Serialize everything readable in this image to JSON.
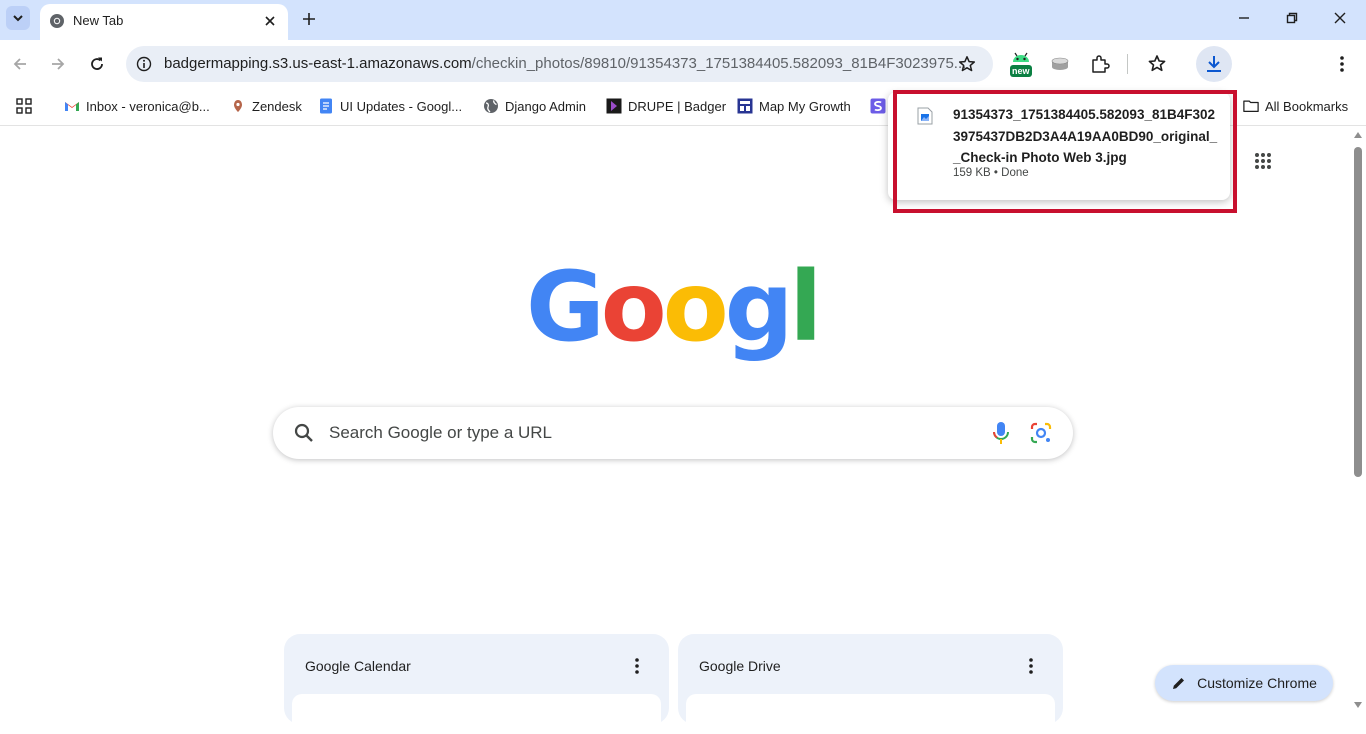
{
  "tab": {
    "title": "New Tab"
  },
  "omnibox": {
    "url_host": "badgermapping.s3.us-east-1.amazonaws.com",
    "url_path": "/checkin_photos/89810/91354373_1751384405.582093_81B4F3023975..."
  },
  "extensions": {
    "badge_label": "new"
  },
  "bookmarks": [
    {
      "label": "Inbox - veronica@b...",
      "icon": "gmail-icon"
    },
    {
      "label": "Zendesk",
      "icon": "zendesk-icon"
    },
    {
      "label": "UI Updates - Googl...",
      "icon": "google-docs-icon"
    },
    {
      "label": "Django Admin",
      "icon": "globe-icon"
    },
    {
      "label": "DRUPE | Badger",
      "icon": "drupe-icon"
    },
    {
      "label": "Map My Growth",
      "icon": "map-my-growth-icon"
    }
  ],
  "all_bookmarks_label": "All Bookmarks",
  "download": {
    "filename": "91354373_1751384405.582093_81B4F3023975437DB2D3A4A19AA0BD90_original__Check-in Photo Web 3.jpg",
    "meta": "159 KB • Done"
  },
  "search": {
    "placeholder": "Search Google or type a URL"
  },
  "logo_text": "Google",
  "cards": [
    {
      "title": "Google Calendar"
    },
    {
      "title": "Google Drive"
    }
  ],
  "customize_label": "Customize Chrome",
  "colors": {
    "tabstrip": "#d3e3fd",
    "omnibox": "#e9eef6",
    "highlight": "#c8102e",
    "google_blue": "#4285f4",
    "google_red": "#ea4335",
    "google_yellow": "#fbbc05",
    "google_green": "#34a853"
  }
}
